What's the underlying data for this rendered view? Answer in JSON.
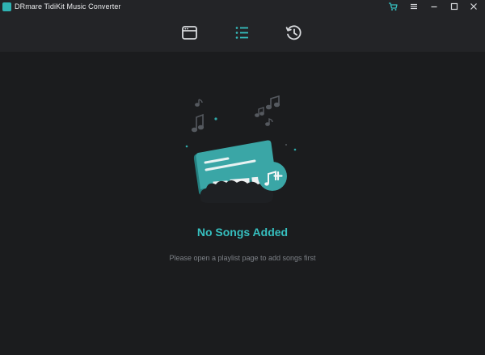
{
  "app": {
    "title": "DRmare TidiKit Music Converter"
  },
  "titlebar": {
    "icons": [
      "cart-icon",
      "menu-icon",
      "minimize-icon",
      "maximize-icon",
      "close-icon"
    ]
  },
  "toolbar": {
    "icons": [
      "browser-icon",
      "list-icon",
      "history-icon"
    ],
    "active": "list-icon"
  },
  "empty_state": {
    "title": "No Songs Added",
    "hint": "Please open a playlist page to add songs first"
  },
  "colors": {
    "accent": "#36bfbf",
    "background": "#1b1c1e",
    "header": "#232427"
  }
}
